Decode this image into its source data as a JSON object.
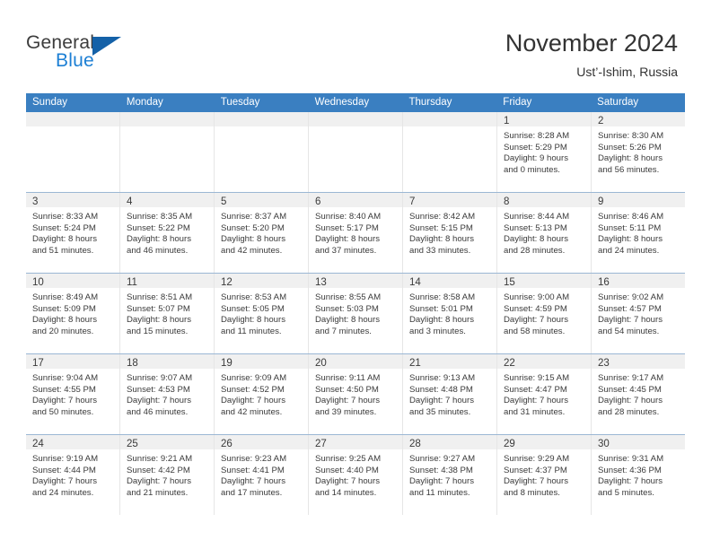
{
  "brand": {
    "word_one": "General",
    "word_two": "Blue",
    "triangle_icon": "triangle-icon",
    "colors": {
      "general": "#3c3c3c",
      "blue": "#1c7fd4",
      "triangle": "#1461a8"
    }
  },
  "header": {
    "title": "November 2024",
    "subtitle": "Ust’-Ishim, Russia"
  },
  "theme": {
    "header_row_bg": "#3a7fc1",
    "header_row_text": "#ffffff",
    "daynum_bg": "#f0f0f0",
    "cell_bg": "#ffffff",
    "grid_line": "#9bb7d4",
    "text": "#3a3a3a"
  },
  "calendar": {
    "weekday_headers": [
      "Sunday",
      "Monday",
      "Tuesday",
      "Wednesday",
      "Thursday",
      "Friday",
      "Saturday"
    ],
    "labels": {
      "sunrise": "Sunrise:",
      "sunset": "Sunset:",
      "daylight": "Daylight:"
    },
    "weeks": [
      [
        {
          "day": "",
          "sunrise": "",
          "sunset": "",
          "daylight_1": "",
          "daylight_2": ""
        },
        {
          "day": "",
          "sunrise": "",
          "sunset": "",
          "daylight_1": "",
          "daylight_2": ""
        },
        {
          "day": "",
          "sunrise": "",
          "sunset": "",
          "daylight_1": "",
          "daylight_2": ""
        },
        {
          "day": "",
          "sunrise": "",
          "sunset": "",
          "daylight_1": "",
          "daylight_2": ""
        },
        {
          "day": "",
          "sunrise": "",
          "sunset": "",
          "daylight_1": "",
          "daylight_2": ""
        },
        {
          "day": "1",
          "sunrise": "Sunrise: 8:28 AM",
          "sunset": "Sunset: 5:29 PM",
          "daylight_1": "Daylight: 9 hours",
          "daylight_2": "and 0 minutes."
        },
        {
          "day": "2",
          "sunrise": "Sunrise: 8:30 AM",
          "sunset": "Sunset: 5:26 PM",
          "daylight_1": "Daylight: 8 hours",
          "daylight_2": "and 56 minutes."
        }
      ],
      [
        {
          "day": "3",
          "sunrise": "Sunrise: 8:33 AM",
          "sunset": "Sunset: 5:24 PM",
          "daylight_1": "Daylight: 8 hours",
          "daylight_2": "and 51 minutes."
        },
        {
          "day": "4",
          "sunrise": "Sunrise: 8:35 AM",
          "sunset": "Sunset: 5:22 PM",
          "daylight_1": "Daylight: 8 hours",
          "daylight_2": "and 46 minutes."
        },
        {
          "day": "5",
          "sunrise": "Sunrise: 8:37 AM",
          "sunset": "Sunset: 5:20 PM",
          "daylight_1": "Daylight: 8 hours",
          "daylight_2": "and 42 minutes."
        },
        {
          "day": "6",
          "sunrise": "Sunrise: 8:40 AM",
          "sunset": "Sunset: 5:17 PM",
          "daylight_1": "Daylight: 8 hours",
          "daylight_2": "and 37 minutes."
        },
        {
          "day": "7",
          "sunrise": "Sunrise: 8:42 AM",
          "sunset": "Sunset: 5:15 PM",
          "daylight_1": "Daylight: 8 hours",
          "daylight_2": "and 33 minutes."
        },
        {
          "day": "8",
          "sunrise": "Sunrise: 8:44 AM",
          "sunset": "Sunset: 5:13 PM",
          "daylight_1": "Daylight: 8 hours",
          "daylight_2": "and 28 minutes."
        },
        {
          "day": "9",
          "sunrise": "Sunrise: 8:46 AM",
          "sunset": "Sunset: 5:11 PM",
          "daylight_1": "Daylight: 8 hours",
          "daylight_2": "and 24 minutes."
        }
      ],
      [
        {
          "day": "10",
          "sunrise": "Sunrise: 8:49 AM",
          "sunset": "Sunset: 5:09 PM",
          "daylight_1": "Daylight: 8 hours",
          "daylight_2": "and 20 minutes."
        },
        {
          "day": "11",
          "sunrise": "Sunrise: 8:51 AM",
          "sunset": "Sunset: 5:07 PM",
          "daylight_1": "Daylight: 8 hours",
          "daylight_2": "and 15 minutes."
        },
        {
          "day": "12",
          "sunrise": "Sunrise: 8:53 AM",
          "sunset": "Sunset: 5:05 PM",
          "daylight_1": "Daylight: 8 hours",
          "daylight_2": "and 11 minutes."
        },
        {
          "day": "13",
          "sunrise": "Sunrise: 8:55 AM",
          "sunset": "Sunset: 5:03 PM",
          "daylight_1": "Daylight: 8 hours",
          "daylight_2": "and 7 minutes."
        },
        {
          "day": "14",
          "sunrise": "Sunrise: 8:58 AM",
          "sunset": "Sunset: 5:01 PM",
          "daylight_1": "Daylight: 8 hours",
          "daylight_2": "and 3 minutes."
        },
        {
          "day": "15",
          "sunrise": "Sunrise: 9:00 AM",
          "sunset": "Sunset: 4:59 PM",
          "daylight_1": "Daylight: 7 hours",
          "daylight_2": "and 58 minutes."
        },
        {
          "day": "16",
          "sunrise": "Sunrise: 9:02 AM",
          "sunset": "Sunset: 4:57 PM",
          "daylight_1": "Daylight: 7 hours",
          "daylight_2": "and 54 minutes."
        }
      ],
      [
        {
          "day": "17",
          "sunrise": "Sunrise: 9:04 AM",
          "sunset": "Sunset: 4:55 PM",
          "daylight_1": "Daylight: 7 hours",
          "daylight_2": "and 50 minutes."
        },
        {
          "day": "18",
          "sunrise": "Sunrise: 9:07 AM",
          "sunset": "Sunset: 4:53 PM",
          "daylight_1": "Daylight: 7 hours",
          "daylight_2": "and 46 minutes."
        },
        {
          "day": "19",
          "sunrise": "Sunrise: 9:09 AM",
          "sunset": "Sunset: 4:52 PM",
          "daylight_1": "Daylight: 7 hours",
          "daylight_2": "and 42 minutes."
        },
        {
          "day": "20",
          "sunrise": "Sunrise: 9:11 AM",
          "sunset": "Sunset: 4:50 PM",
          "daylight_1": "Daylight: 7 hours",
          "daylight_2": "and 39 minutes."
        },
        {
          "day": "21",
          "sunrise": "Sunrise: 9:13 AM",
          "sunset": "Sunset: 4:48 PM",
          "daylight_1": "Daylight: 7 hours",
          "daylight_2": "and 35 minutes."
        },
        {
          "day": "22",
          "sunrise": "Sunrise: 9:15 AM",
          "sunset": "Sunset: 4:47 PM",
          "daylight_1": "Daylight: 7 hours",
          "daylight_2": "and 31 minutes."
        },
        {
          "day": "23",
          "sunrise": "Sunrise: 9:17 AM",
          "sunset": "Sunset: 4:45 PM",
          "daylight_1": "Daylight: 7 hours",
          "daylight_2": "and 28 minutes."
        }
      ],
      [
        {
          "day": "24",
          "sunrise": "Sunrise: 9:19 AM",
          "sunset": "Sunset: 4:44 PM",
          "daylight_1": "Daylight: 7 hours",
          "daylight_2": "and 24 minutes."
        },
        {
          "day": "25",
          "sunrise": "Sunrise: 9:21 AM",
          "sunset": "Sunset: 4:42 PM",
          "daylight_1": "Daylight: 7 hours",
          "daylight_2": "and 21 minutes."
        },
        {
          "day": "26",
          "sunrise": "Sunrise: 9:23 AM",
          "sunset": "Sunset: 4:41 PM",
          "daylight_1": "Daylight: 7 hours",
          "daylight_2": "and 17 minutes."
        },
        {
          "day": "27",
          "sunrise": "Sunrise: 9:25 AM",
          "sunset": "Sunset: 4:40 PM",
          "daylight_1": "Daylight: 7 hours",
          "daylight_2": "and 14 minutes."
        },
        {
          "day": "28",
          "sunrise": "Sunrise: 9:27 AM",
          "sunset": "Sunset: 4:38 PM",
          "daylight_1": "Daylight: 7 hours",
          "daylight_2": "and 11 minutes."
        },
        {
          "day": "29",
          "sunrise": "Sunrise: 9:29 AM",
          "sunset": "Sunset: 4:37 PM",
          "daylight_1": "Daylight: 7 hours",
          "daylight_2": "and 8 minutes."
        },
        {
          "day": "30",
          "sunrise": "Sunrise: 9:31 AM",
          "sunset": "Sunset: 4:36 PM",
          "daylight_1": "Daylight: 7 hours",
          "daylight_2": "and 5 minutes."
        }
      ]
    ]
  }
}
